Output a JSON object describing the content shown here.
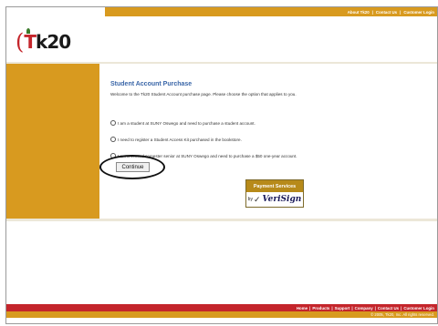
{
  "topnav": {
    "items": [
      "About Tk20",
      "Contact Us",
      "Customer Login"
    ]
  },
  "logo": {
    "paren": "(",
    "t": "T",
    "k20": "k20"
  },
  "main": {
    "title": "Student Account Purchase",
    "intro": "Welcome to the Tk20 Student Account purchase page. Please choose the option that applies to you.",
    "options": [
      {
        "label": "I am a student at SUNY Oswego and need to purchase a student account."
      },
      {
        "label": "I need to register a Student Access Kit purchased in the bookstore."
      },
      {
        "label": "I am a second semester senior at SUNY Oswego and need to purchase a $50 one-year account."
      }
    ],
    "continue_label": "Continue"
  },
  "badge": {
    "top": "Payment Services",
    "by": "by",
    "brand": "VeriSign"
  },
  "footer": {
    "links": [
      "Home",
      "Products",
      "Support",
      "Company",
      "Contact Us",
      "Customer Login"
    ],
    "copyright": "© 2005, Tk20, Inc. All rights reserved."
  },
  "colors": {
    "orange": "#d89a1f",
    "red": "#c4252b",
    "title_blue": "#3a66a8"
  }
}
